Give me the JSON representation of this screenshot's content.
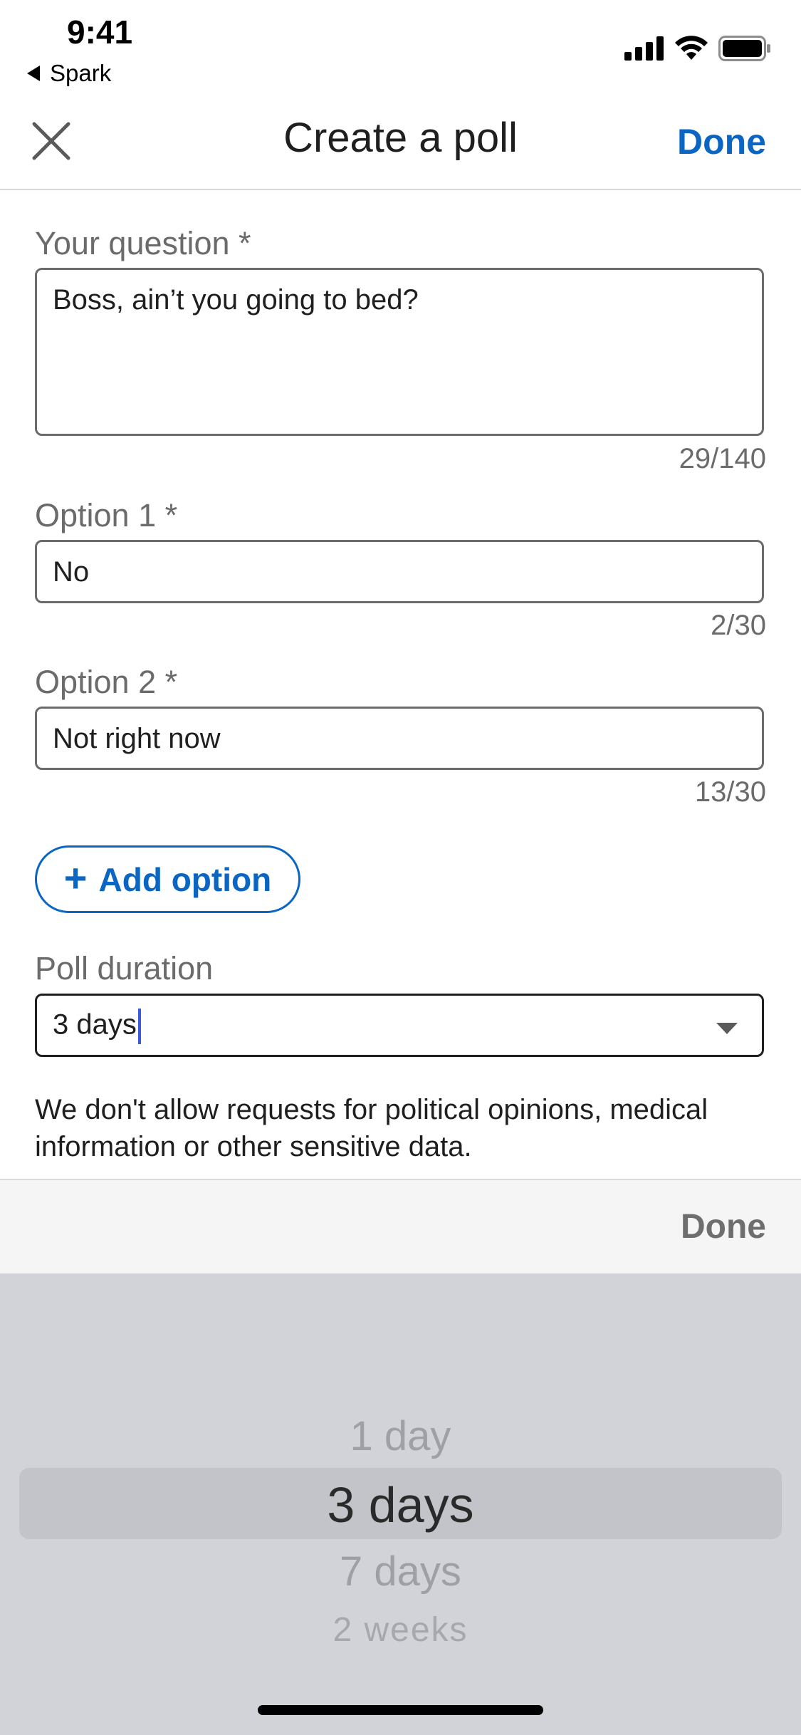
{
  "status_bar": {
    "time": "9:41",
    "back_app": "Spark"
  },
  "header": {
    "title": "Create a poll",
    "done_label": "Done"
  },
  "question": {
    "label": "Your question *",
    "value": "Boss, ain’t you going to bed?",
    "counter": "29/140"
  },
  "options": [
    {
      "label": "Option 1 *",
      "value": "No",
      "counter": "2/30"
    },
    {
      "label": "Option 2 *",
      "value": "Not right now",
      "counter": "13/30"
    }
  ],
  "add_option_label": "Add option",
  "duration": {
    "label": "Poll duration",
    "value": "3 days"
  },
  "disclaimer": "We don't allow requests for political opinions, medical information or other sensitive data.",
  "picker": {
    "done_label": "Done",
    "items": [
      "1 day",
      "3 days",
      "7 days",
      "2 weeks"
    ],
    "selected": "3 days"
  },
  "colors": {
    "accent": "#0a66c2",
    "picker_bg": "#d1d3d9",
    "caret": "#3b5bdb"
  }
}
